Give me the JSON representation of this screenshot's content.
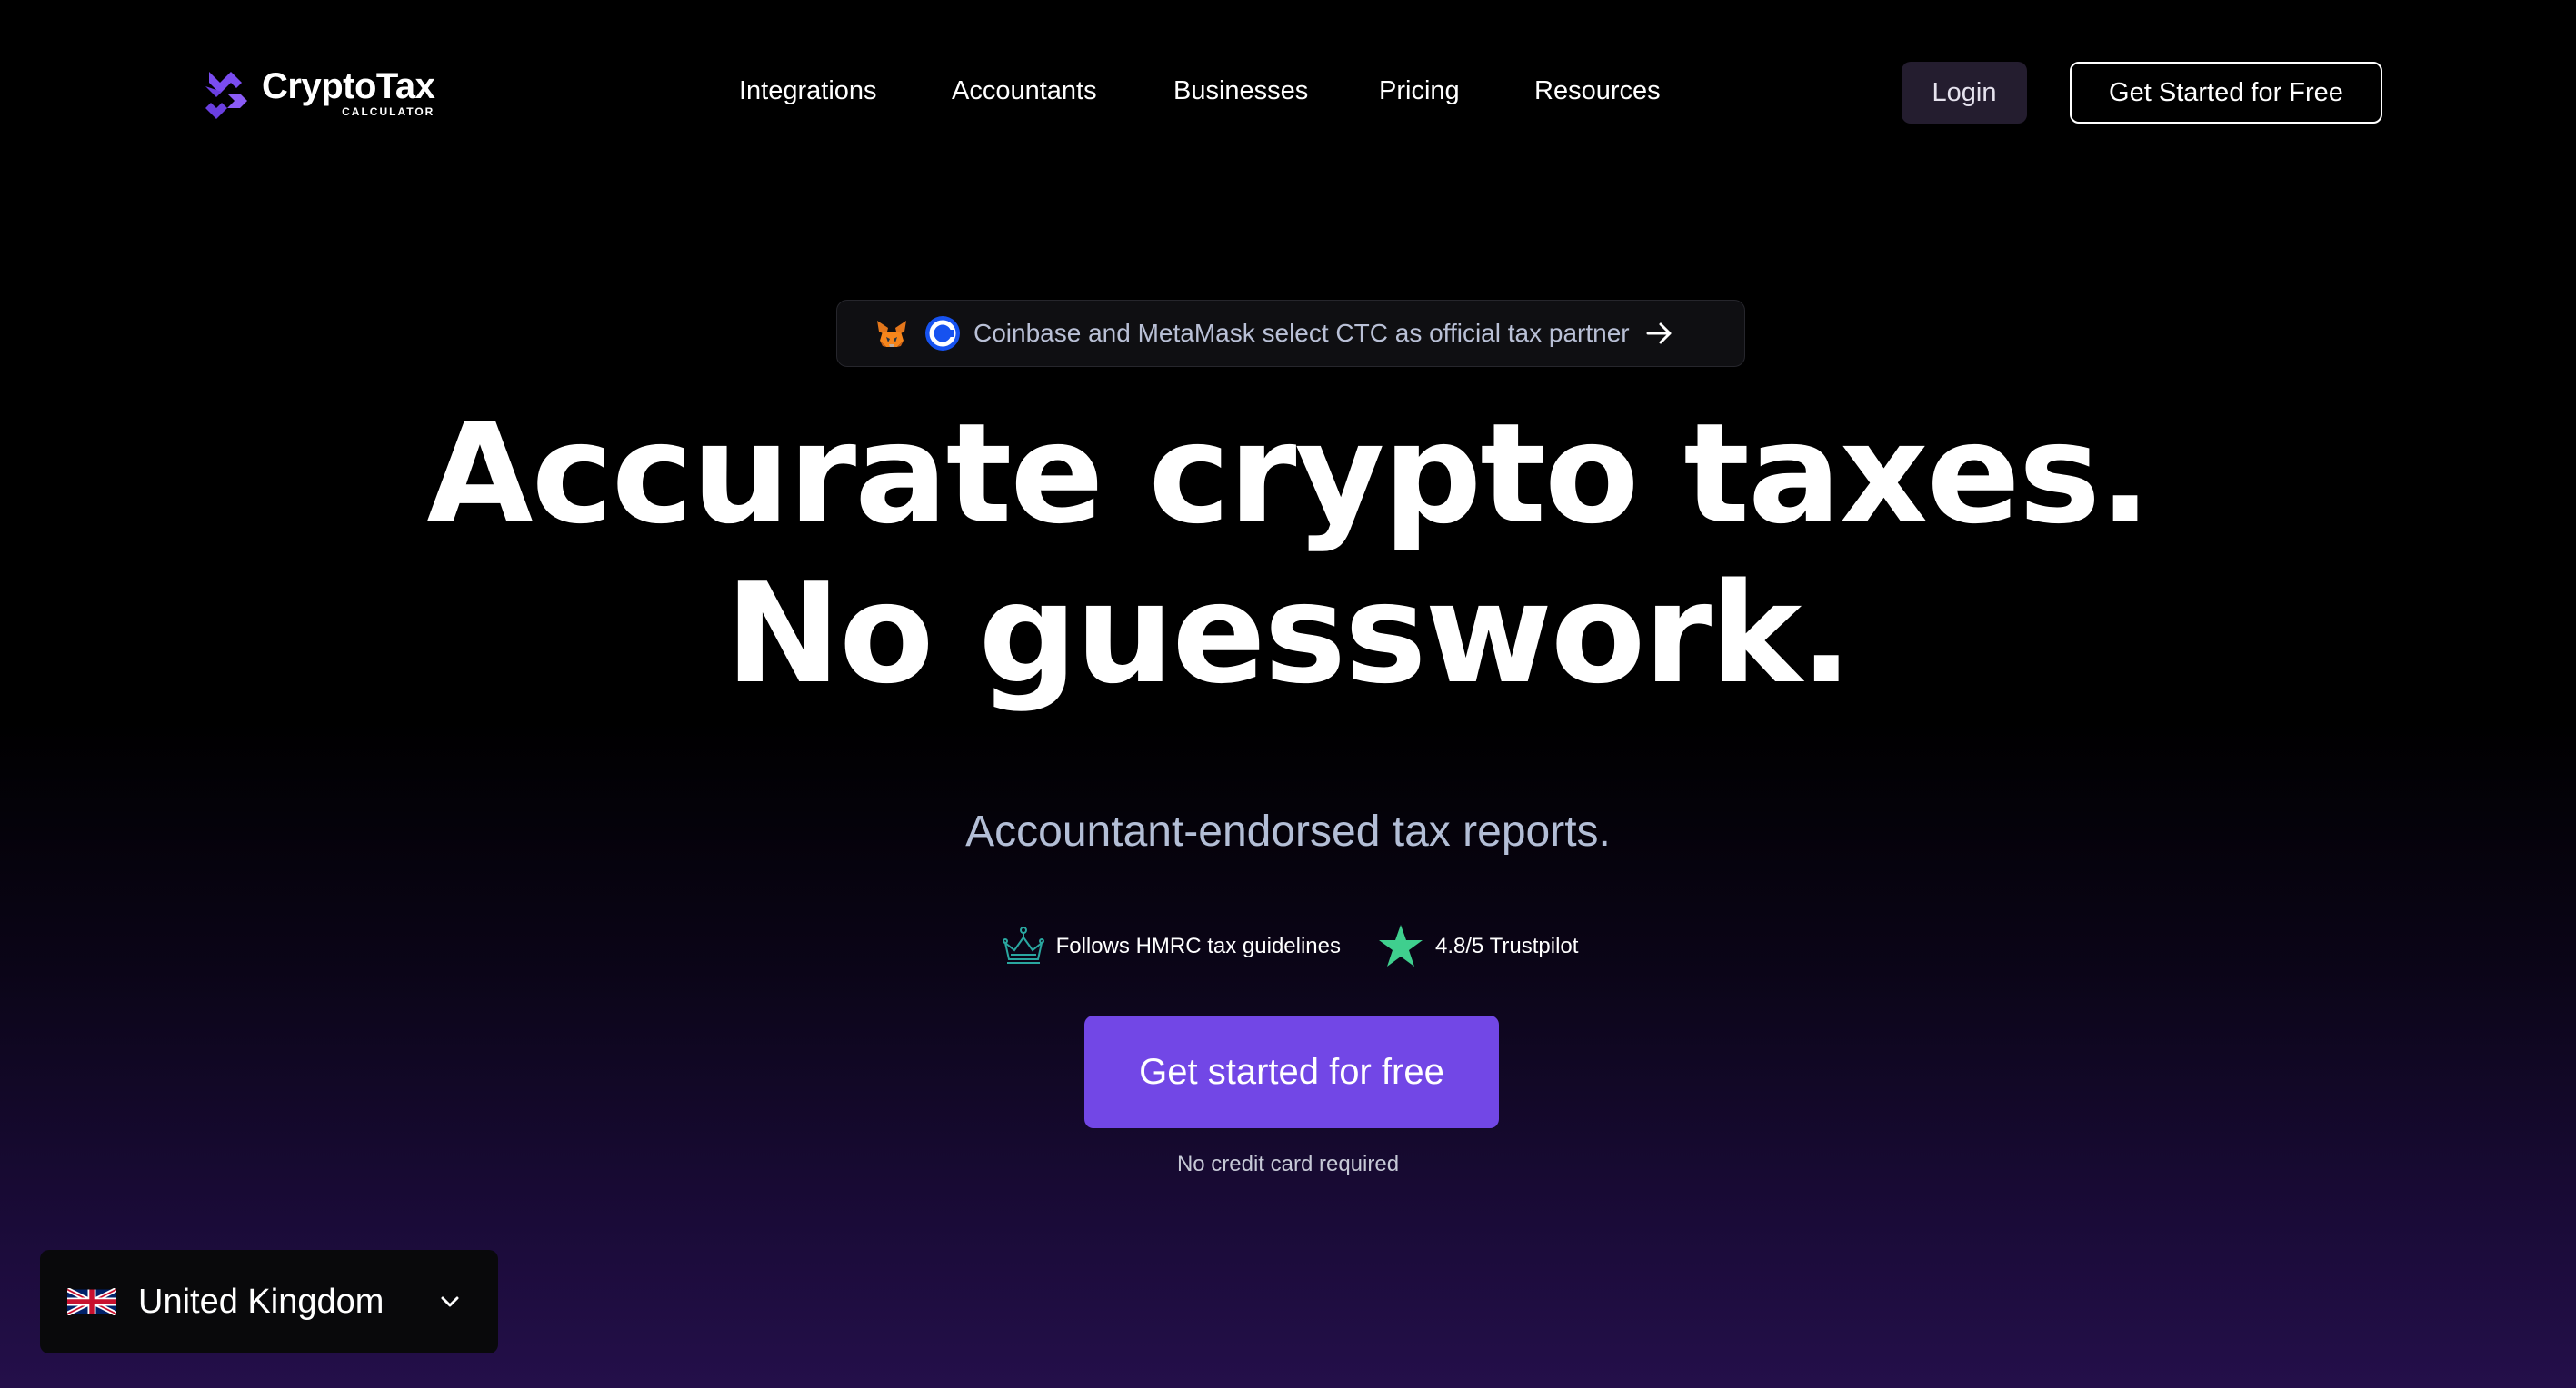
{
  "brand": {
    "name": "CryptoTax",
    "subtitle": "CALCULATOR",
    "accent": "#7247e6"
  },
  "nav": {
    "items": [
      {
        "label": "Integrations"
      },
      {
        "label": "Accountants"
      },
      {
        "label": "Businesses"
      },
      {
        "label": "Pricing"
      },
      {
        "label": "Resources"
      }
    ]
  },
  "header": {
    "login_label": "Login",
    "get_started_label": "Get Started for Free"
  },
  "announcement": {
    "text": "Coinbase and MetaMask select CTC as official tax partner",
    "icons": [
      "metamask-fox-icon",
      "coinbase-icon",
      "arrow-right-icon"
    ]
  },
  "hero": {
    "headline_line1": "Accurate crypto taxes.",
    "headline_line2": "No guesswork.",
    "subheadline": "Accountant-endorsed tax reports.",
    "badges": [
      {
        "icon": "crown-icon",
        "text": "Follows HMRC tax guidelines"
      },
      {
        "icon": "star-icon",
        "text": "4.8/5 Trustpilot"
      }
    ],
    "cta_label": "Get started for free",
    "cta_note": "No credit card required"
  },
  "region_selector": {
    "icon": "uk-flag-icon",
    "label": "United Kingdom"
  }
}
